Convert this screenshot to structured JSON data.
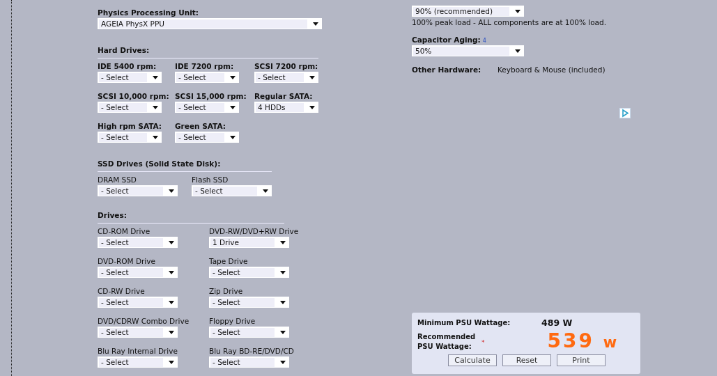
{
  "ppu": {
    "label": "Physics Processing Unit:",
    "value": "AGEIA PhysX PPU"
  },
  "hard_drives": {
    "title": "Hard Drives:",
    "fields": [
      {
        "label": "IDE 5400 rpm:",
        "value": "- Select"
      },
      {
        "label": "IDE 7200 rpm:",
        "value": "- Select"
      },
      {
        "label": "SCSI 7200 rpm:",
        "value": "- Select"
      },
      {
        "label": "SCSI 10,000 rpm:",
        "value": "- Select"
      },
      {
        "label": "SCSI 15,000 rpm:",
        "value": "- Select"
      },
      {
        "label": "Regular SATA:",
        "value": "4 HDDs"
      },
      {
        "label": "High rpm SATA:",
        "value": "- Select"
      },
      {
        "label": "Green SATA:",
        "value": "- Select"
      }
    ]
  },
  "ssd": {
    "title": "SSD Drives (Solid State Disk):",
    "fields": [
      {
        "label": "DRAM SSD",
        "value": "- Select"
      },
      {
        "label": "Flash SSD",
        "value": "- Select"
      }
    ]
  },
  "drives": {
    "title": "Drives:",
    "fields": [
      {
        "label": "CD-ROM Drive",
        "value": "- Select"
      },
      {
        "label": "DVD-RW/DVD+RW Drive",
        "value": "1 Drive"
      },
      {
        "label": "DVD-ROM Drive",
        "value": "- Select"
      },
      {
        "label": "Tape Drive",
        "value": "- Select"
      },
      {
        "label": "CD-RW Drive",
        "value": "- Select"
      },
      {
        "label": "Zip Drive",
        "value": "- Select"
      },
      {
        "label": "DVD/CDRW Combo Drive",
        "value": "- Select"
      },
      {
        "label": "Floppy Drive",
        "value": "- Select"
      },
      {
        "label": "Blu Ray Internal Drive",
        "value": "- Select"
      },
      {
        "label": "Blu Ray BD-RE/DVD/CD",
        "value": "- Select"
      }
    ]
  },
  "system_load": {
    "value": "90% (recommended)",
    "note": "100% peak load - ALL components are at 100% load."
  },
  "capacitor_aging": {
    "label": "Capacitor Aging:",
    "footnote": "4",
    "value": "50%"
  },
  "other_hardware": {
    "label": "Other Hardware:",
    "value": "Keyboard & Mouse (included)"
  },
  "result": {
    "minimum_label": "Minimum PSU Wattage:",
    "minimum_value": "489 W",
    "recommended_label": "Recommended PSU Wattage:",
    "asterisk": "*",
    "recommended_number": "539",
    "recommended_unit": "w",
    "buttons": [
      "Calculate",
      "Reset",
      "Print"
    ]
  }
}
